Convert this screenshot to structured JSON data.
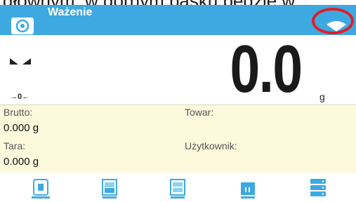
{
  "caption": "głównym, w górnym pasku będzie w",
  "header": {
    "title": "Ważenie",
    "app_icon": "scale-dial-icon",
    "status_icon": "wifi-icon",
    "bar_color": "#3ea9e0",
    "highlight_color": "#e11d25"
  },
  "reading": {
    "value": "0.0",
    "unit": "g",
    "zero_marker": "→0←",
    "stability_icon": "stability-marker-icon"
  },
  "info": {
    "gross_label": "Brutto:",
    "gross_value": "0.000 g",
    "tare_label": "Tara:",
    "tare_value": "0.000 g",
    "product_label": "Towar:",
    "product_value": "",
    "user_label": "Użytkownik:",
    "user_value": ""
  },
  "bottom_icons": [
    "tare-icon",
    "product-database-icon",
    "packaging-database-icon",
    "statistics-icon",
    "databases-icon"
  ]
}
